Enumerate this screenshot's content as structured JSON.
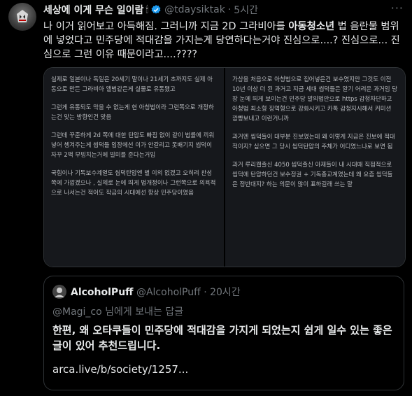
{
  "tweet": {
    "author_name": "세상에 이게 무슨 일이람",
    "author_badge": "🕯",
    "handle": "@tdaysiktak",
    "dot": "·",
    "time": "5시간",
    "text_parts": [
      "나 이거 읽어보고 아득해짐. 그러니까 지금 2D 그라비아를 ",
      "아동청소년",
      " 법 음란물 범위에 넣었다고 민주당에 적대감을 가지는게 당연하다는거야 진심으로....? 진심으로... 진심으로 그런 이유 때문이라고....????"
    ],
    "colors": {
      "background": "#000000",
      "text": "#e7e9ea",
      "muted": "#71767b",
      "verified": "#1d9bf0"
    }
  },
  "media": {
    "left_paragraphs": [
      "실제로 일본이나 독일은 20세기 말이나 21세기 초까지도 실제 아동으로 만든 그라비아 앨범같은게 실물로 유통됐고",
      "그런게 유통되도 막을 수 없는게 현 아청법이라 그런쪽으로 개정하는건 맞는 방향인건 맞음",
      "그런데 꾸준하게 2d 쪽에 대한 탄압도 빠짐 없이 같이 법률에 끼워넣어 쳉겨주는게 씹덕들 입장에선 이가 안갈리고 못배기지 씹덕이 자꾸 2백 무빙치는거에 빌미를 준다는거임",
      "국힘이나 기독보수계열도 씹덕탄압엔 별 이의 없겠고 오히려 찬성쪽에 가깝겠으나 , 실제로 눈에 띄게 법개정이나 그런쪽으로 의욕적으로 나서는건 적어도 작금의 시대에선 항상 민주당이였음"
    ],
    "right_paragraphs": [
      "가상을 처음으로 아청법으로 집어넣은건 보수였지만 그것도 이전 10년 이상 더 된 과거고 지금 세대 씹덕들은 알기 어려운 과거임 당장 눈에 띄게 보이는건 민주당 발의법안으로 https 감청차단하고 아청법 최소형 징역형으로 강화시키고 카톡 감청지시해서 커미션 깜빵보내고 이런거니까",
      "과거엔 씹덕들이 대부분 진보였는데 왜 이렇게 지금은 진보에 적대적이지? 싶으면 그 당시 씹덕탄압의 주체가 어디였느냐로 보면 됨",
      "과거 루리웹출신 4050 씹덕출신 아재들이 내 시대때 직접적으로 씹덕에 탄압하던건 보수정권 + 기독종교계였는데 왜 요즘 씹덕들은 정반대지? 하는 의문이 많이 표하길래 쓰는 말"
    ]
  },
  "quote": {
    "name": "AlcoholPuff",
    "handle": "@AlcoholPuff",
    "dot": "·",
    "time": "20시간",
    "reply_mention": "@Magi_co",
    "reply_suffix": " 님에게 보내는 답글",
    "text": "한편, 왜 오타쿠들이 민주당에 적대감을 가지게 되었는지 쉽게 일수 있는 좋은 글이 있어 추천드립니다.",
    "link": "arca.live/b/society/1257..."
  }
}
